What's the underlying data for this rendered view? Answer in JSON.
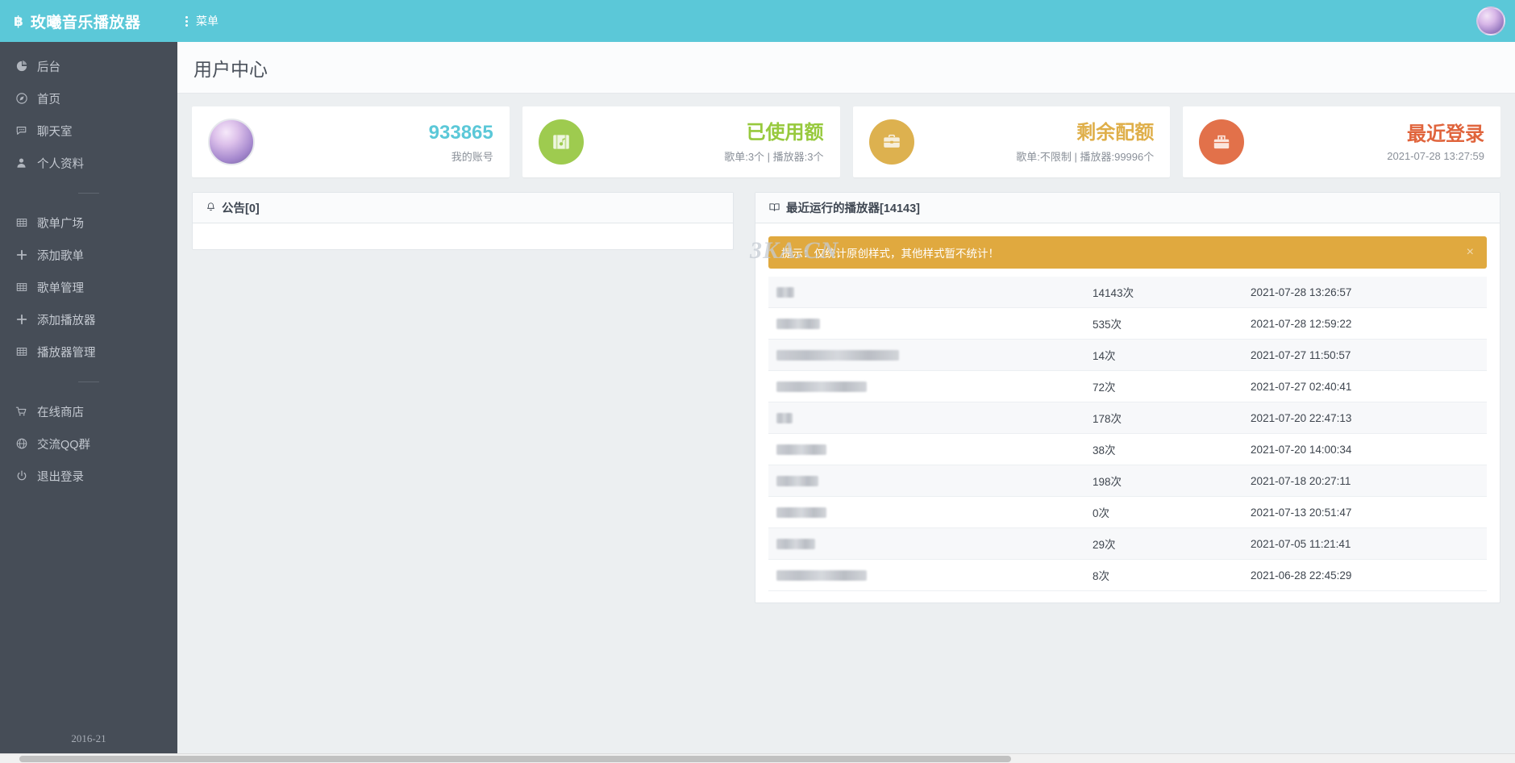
{
  "topbar": {
    "brand_mark": "฿",
    "brand": "玫曦音乐播放器",
    "menu_label": "菜单",
    "avatar_name": "user-avatar"
  },
  "sidebar": {
    "items": [
      {
        "label": "后台",
        "icon": "pie-chart-icon",
        "name": "sidebar-item-backend"
      },
      {
        "label": "首页",
        "icon": "compass-icon",
        "name": "sidebar-item-home"
      },
      {
        "label": "聊天室",
        "icon": "chat-icon",
        "name": "sidebar-item-chatroom"
      },
      {
        "label": "个人资料",
        "icon": "user-icon",
        "name": "sidebar-item-profile"
      },
      {
        "label": "歌单广场",
        "icon": "grid-icon",
        "name": "sidebar-item-playlist-square"
      },
      {
        "label": "添加歌单",
        "icon": "plus-icon",
        "name": "sidebar-item-add-playlist"
      },
      {
        "label": "歌单管理",
        "icon": "grid-icon",
        "name": "sidebar-item-manage-playlist"
      },
      {
        "label": "添加播放器",
        "icon": "plus-icon",
        "name": "sidebar-item-add-player"
      },
      {
        "label": "播放器管理",
        "icon": "grid-icon",
        "name": "sidebar-item-manage-player"
      },
      {
        "label": "在线商店",
        "icon": "cart-icon",
        "name": "sidebar-item-store"
      },
      {
        "label": "交流QQ群",
        "icon": "globe-icon",
        "name": "sidebar-item-qq-group"
      },
      {
        "label": "退出登录",
        "icon": "power-icon",
        "name": "sidebar-item-logout"
      }
    ],
    "footer": "2016-21"
  },
  "page": {
    "title": "用户中心",
    "watermark": "3KA.CN"
  },
  "cards": [
    {
      "name": "account-card",
      "icon": "avatar-icon",
      "value": "933865",
      "sub": "我的账号",
      "color": "#5bc8d8",
      "icon_bg": "avatar"
    },
    {
      "name": "used-quota-card",
      "icon": "music-album-icon",
      "value": "已使用额",
      "sub": "歌单:3个 | 播放器:3个",
      "color": "#97c93d",
      "icon_bg": "#9ecb4f"
    },
    {
      "name": "remaining-quota-card",
      "icon": "briefcase-icon",
      "value": "剩余配额",
      "sub": "歌单:不限制 | 播放器:99996个",
      "color": "#dfaf4a",
      "icon_bg": "#ddb14f"
    },
    {
      "name": "last-login-card",
      "icon": "inbox-icon",
      "value": "最近登录",
      "sub": "2021-07-28 13:27:59",
      "color": "#e0643c",
      "icon_bg": "#e2714a"
    }
  ],
  "notice_panel": {
    "icon": "bell-icon",
    "title": "公告[0]",
    "body": ""
  },
  "runs_panel": {
    "icon": "book-icon",
    "title": "最近运行的播放器[14143]",
    "alert": {
      "text": "提示：仅统计原创样式，其他样式暂不统计！",
      "close_label": "×",
      "color": "#e0a93f"
    },
    "rows": [
      {
        "name": "",
        "name_redacted_width": 22,
        "count": "14143次",
        "time": "2021-07-28 13:26:57"
      },
      {
        "name": "",
        "name_redacted_width": 54,
        "count": "535次",
        "time": "2021-07-28 12:59:22"
      },
      {
        "name": "",
        "name_redacted_width": 152,
        "count": "14次",
        "time": "2021-07-27 11:50:57"
      },
      {
        "name": "",
        "name_redacted_width": 112,
        "count": "72次",
        "time": "2021-07-27 02:40:41"
      },
      {
        "name": "",
        "name_redacted_width": 20,
        "count": "178次",
        "time": "2021-07-20 22:47:13"
      },
      {
        "name": "",
        "name_redacted_width": 62,
        "count": "38次",
        "time": "2021-07-20 14:00:34"
      },
      {
        "name": "",
        "name_redacted_width": 52,
        "count": "198次",
        "time": "2021-07-18 20:27:11"
      },
      {
        "name": "",
        "name_redacted_width": 62,
        "count": "0次",
        "time": "2021-07-13 20:51:47"
      },
      {
        "name": "",
        "name_redacted_width": 48,
        "count": "29次",
        "time": "2021-07-05 11:21:41"
      },
      {
        "name": "",
        "name_redacted_width": 112,
        "count": "8次",
        "time": "2021-06-28 22:45:29"
      }
    ]
  }
}
